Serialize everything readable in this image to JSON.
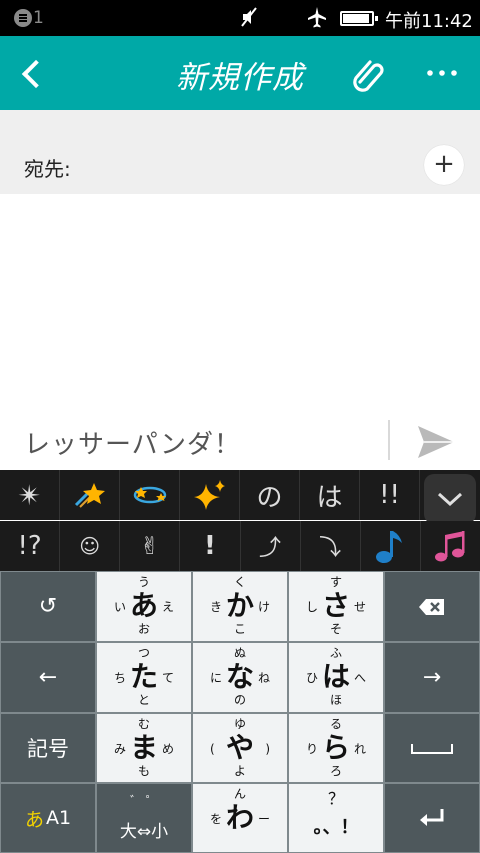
{
  "status_bar": {
    "notif_count": "1",
    "time": "午前11:42"
  },
  "app_bar": {
    "title": "新規作成"
  },
  "recipient": {
    "label": "宛先:"
  },
  "compose": {
    "text": "レッサーパンダ！"
  },
  "candidates_row1": [
    "✴",
    "☄",
    "💫",
    "✨",
    "の",
    "は",
    "!!"
  ],
  "candidates_row2": [
    "!?",
    "☺",
    "✌",
    "!",
    "⤴",
    "⤵",
    "♪",
    "♫"
  ],
  "keyboard": {
    "undo": "↺",
    "backspace": "⌫",
    "left": "←",
    "right": "→",
    "kigou": "記号",
    "space": "␣",
    "mode": "あA1",
    "enter": "↵",
    "a": {
      "main": "あ",
      "top": "う",
      "bottom": "お",
      "left": "い",
      "right": "え"
    },
    "ka": {
      "main": "か",
      "top": "く",
      "bottom": "こ",
      "left": "き",
      "right": "け"
    },
    "sa": {
      "main": "さ",
      "top": "す",
      "bottom": "そ",
      "left": "し",
      "right": "せ"
    },
    "ta": {
      "main": "た",
      "top": "つ",
      "bottom": "と",
      "left": "ち",
      "right": "て"
    },
    "na": {
      "main": "な",
      "top": "ぬ",
      "bottom": "の",
      "left": "に",
      "right": "ね"
    },
    "ha": {
      "main": "は",
      "top": "ふ",
      "bottom": "ほ",
      "left": "ひ",
      "right": "へ"
    },
    "ma": {
      "main": "ま",
      "top": "む",
      "bottom": "も",
      "left": "み",
      "right": "め"
    },
    "ya": {
      "main": "や",
      "top": "ゆ",
      "bottom": "よ",
      "left": "(",
      "right": ")"
    },
    "ra": {
      "main": "ら",
      "top": "る",
      "bottom": "ろ",
      "left": "り",
      "right": "れ"
    },
    "dakuten": {
      "main": "大⇔小",
      "top": "゛  ゜"
    },
    "wa": {
      "main": "わ",
      "top": "ん",
      "left": "を",
      "right": "ー"
    },
    "punct": {
      "main": "。、！",
      "top": "？"
    }
  },
  "colors": {
    "accent": "#00a9a7",
    "mode_kana": "#f2d200"
  }
}
